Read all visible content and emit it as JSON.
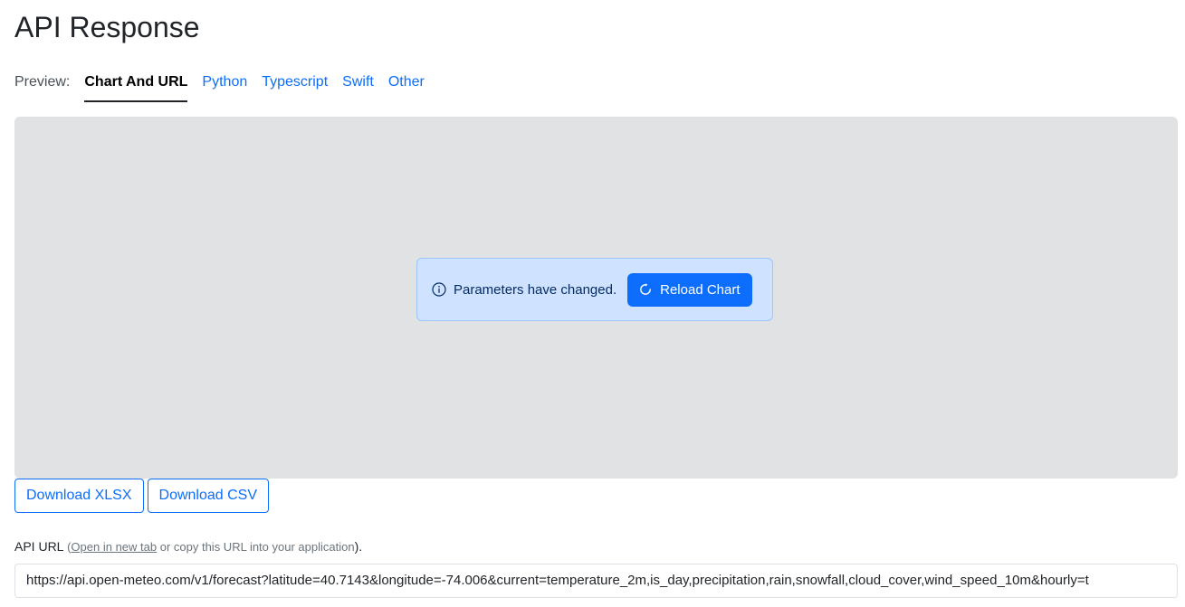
{
  "page": {
    "title": "API Response"
  },
  "tabs": {
    "label": "Preview:",
    "items": [
      {
        "label": "Chart And URL",
        "active": true
      },
      {
        "label": "Python",
        "active": false
      },
      {
        "label": "Typescript",
        "active": false
      },
      {
        "label": "Swift",
        "active": false
      },
      {
        "label": "Other",
        "active": false
      }
    ]
  },
  "alert": {
    "icon": "info-icon",
    "message": "Parameters have changed.",
    "button_icon": "reload-icon",
    "button_label": "Reload Chart"
  },
  "downloads": {
    "xlsx_label": "Download XLSX",
    "csv_label": "Download CSV"
  },
  "api": {
    "label": "API URL",
    "open_paren": " (",
    "link_text": "Open in new tab",
    "after_link": " or copy this URL into your application",
    "close": ").",
    "url": "https://api.open-meteo.com/v1/forecast?latitude=40.7143&longitude=-74.006&current=temperature_2m,is_day,precipitation,rain,snowfall,cloud_cover,wind_speed_10m&hourly=t"
  },
  "colors": {
    "accent": "#0d6efd",
    "chart_bg": "#e1e2e4",
    "alert_bg": "#cfe2ff"
  }
}
